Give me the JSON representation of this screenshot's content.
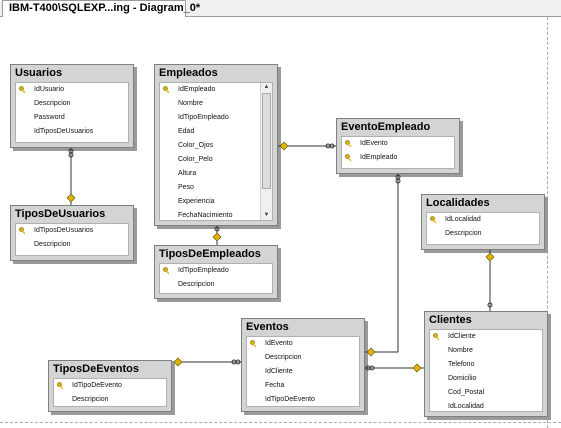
{
  "tab": {
    "label": "IBM-T400\\SQLEXP...ing - Diagram_0*"
  },
  "tables": {
    "usuarios": {
      "title": "Usuarios",
      "columns": [
        "IdUsuario",
        "Descripcion",
        "Password",
        "IdTiposDeUsuarios"
      ]
    },
    "tiposdeusuarios": {
      "title": "TiposDeUsuarios",
      "columns": [
        "IdTiposDeUsuarios",
        "Descripcion"
      ]
    },
    "empleados": {
      "title": "Empleados",
      "columns": [
        "IdEmpleado",
        "Nombre",
        "IdTipoEmpleado",
        "Edad",
        "Color_Ojos",
        "Color_Pelo",
        "Altura",
        "Peso",
        "Experiencia",
        "FechaNacimiento"
      ]
    },
    "tiposdeempleados": {
      "title": "TiposDeEmpleados",
      "columns": [
        "IdTipoEmpleado",
        "Descripcion"
      ]
    },
    "eventoempleado": {
      "title": "EventoEmpleado",
      "columns": [
        "IdEvento",
        "IdEmpleado"
      ]
    },
    "localidades": {
      "title": "Localidades",
      "columns": [
        "IdLocalidad",
        "Descripcion"
      ]
    },
    "clientes": {
      "title": "Clientes",
      "columns": [
        "IdCliente",
        "Nombre",
        "Telefono",
        "Domicilio",
        "Cod_Postal",
        "IdLocalidad"
      ]
    },
    "eventos": {
      "title": "Eventos",
      "columns": [
        "IdEvento",
        "Descripcion",
        "IdCliente",
        "Fecha",
        "IdTipoDeEvento"
      ]
    },
    "tiposdeeventos": {
      "title": "TiposDeEventos",
      "columns": [
        "IdTipoDeEvento",
        "Descripcion"
      ]
    }
  },
  "colors": {
    "key": "#e0b400",
    "header": "#d4d4d4",
    "line": "#333333"
  }
}
